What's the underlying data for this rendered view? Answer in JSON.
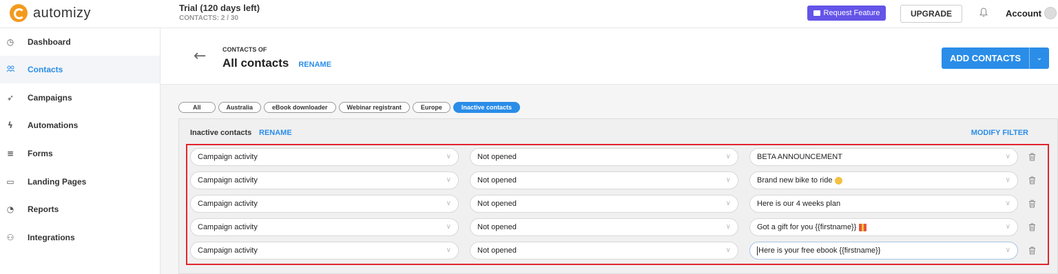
{
  "topbar": {
    "logo_text": "automizy",
    "trial_title": "Trial (120 days left)",
    "trial_sub": "CONTACTS: 2 / 30",
    "request_feature": "Request Feature",
    "upgrade": "UPGRADE",
    "account": "Account",
    "colors": {
      "request_bg": "#6454e8",
      "logo": "#f39a1e"
    }
  },
  "sidebar": {
    "items": [
      {
        "label": "Dashboard",
        "icon": "dashboard-icon",
        "glyph": "◷"
      },
      {
        "label": "Contacts",
        "icon": "contacts-icon",
        "glyph": "👥"
      },
      {
        "label": "Campaigns",
        "icon": "send-icon",
        "glyph": "➶"
      },
      {
        "label": "Automations",
        "icon": "bolt-icon",
        "glyph": "ϟ"
      },
      {
        "label": "Forms",
        "icon": "forms-icon",
        "glyph": "≡"
      },
      {
        "label": "Landing Pages",
        "icon": "page-icon",
        "glyph": "▭"
      },
      {
        "label": "Reports",
        "icon": "reports-icon",
        "glyph": "◔"
      },
      {
        "label": "Integrations",
        "icon": "integrations-icon",
        "glyph": "⚇"
      }
    ],
    "active_index": 1
  },
  "header": {
    "contacts_of": "CONTACTS OF",
    "title": "All contacts",
    "rename": "RENAME",
    "add_contacts": "ADD CONTACTS"
  },
  "tabs": [
    "All",
    "Australia",
    "eBook downloader",
    "Webinar registrant",
    "Europe",
    "Inactive contacts"
  ],
  "active_tab": 5,
  "panel": {
    "title": "Inactive contacts",
    "rename": "RENAME",
    "modify_filter": "MODIFY FILTER"
  },
  "filters": [
    {
      "field": "Campaign activity",
      "condition": "Not opened",
      "value": "BETA ANNOUNCEMENT",
      "emoji": ""
    },
    {
      "field": "Campaign activity",
      "condition": "Not opened",
      "value": "Brand new bike to ride",
      "emoji": "face"
    },
    {
      "field": "Campaign activity",
      "condition": "Not opened",
      "value": "Here is our 4 weeks plan",
      "emoji": ""
    },
    {
      "field": "Campaign activity",
      "condition": "Not opened",
      "value": "Got a gift for you {{firstname}}",
      "emoji": "gift"
    },
    {
      "field": "Campaign activity",
      "condition": "Not opened",
      "value": "Here is your free ebook {{firstname}}",
      "emoji": "",
      "focused": true
    }
  ],
  "accent": "#2a8de8",
  "highlight_border": "#e2242d"
}
